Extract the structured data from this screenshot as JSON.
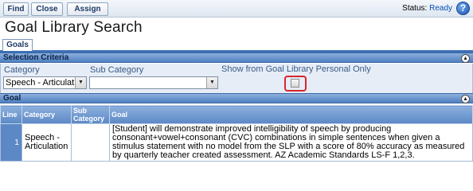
{
  "toolbar": {
    "buttons": [
      {
        "label": "Find"
      },
      {
        "label": "Close"
      },
      {
        "label": "Assign"
      }
    ],
    "status_label": "Status:",
    "status_value": "Ready"
  },
  "page": {
    "title": "Goal Library Search",
    "tabs": [
      {
        "label": "Goals"
      }
    ]
  },
  "criteria": {
    "section_title": "Selection Criteria",
    "category_label": "Category",
    "category_value": "Speech - Articulation",
    "subcategory_label": "Sub Category",
    "subcategory_value": "",
    "personal_only_label": "Show from Goal Library Personal Only",
    "personal_only_checked": false
  },
  "goal_section": {
    "title": "Goal",
    "columns": [
      "Line",
      "Category",
      "Sub Category",
      "Goal"
    ],
    "rows": [
      {
        "line": "1",
        "category": "Speech - Articulation",
        "subcategory": "",
        "goal": "[Student] will demonstrate improved intelligibility of speech by producing consonant+vowel+consonant (CVC) combinations in simple sentences when given a stimulus statement with no model from the SLP with a score of 80% accuracy as measured by quarterly teacher created assessment. AZ Academic Standards LS-F 1,2,3."
      }
    ]
  },
  "colors": {
    "accent": "#3e6fb7",
    "status_ready": "#0a4fb5",
    "highlight": "#d8262b"
  }
}
